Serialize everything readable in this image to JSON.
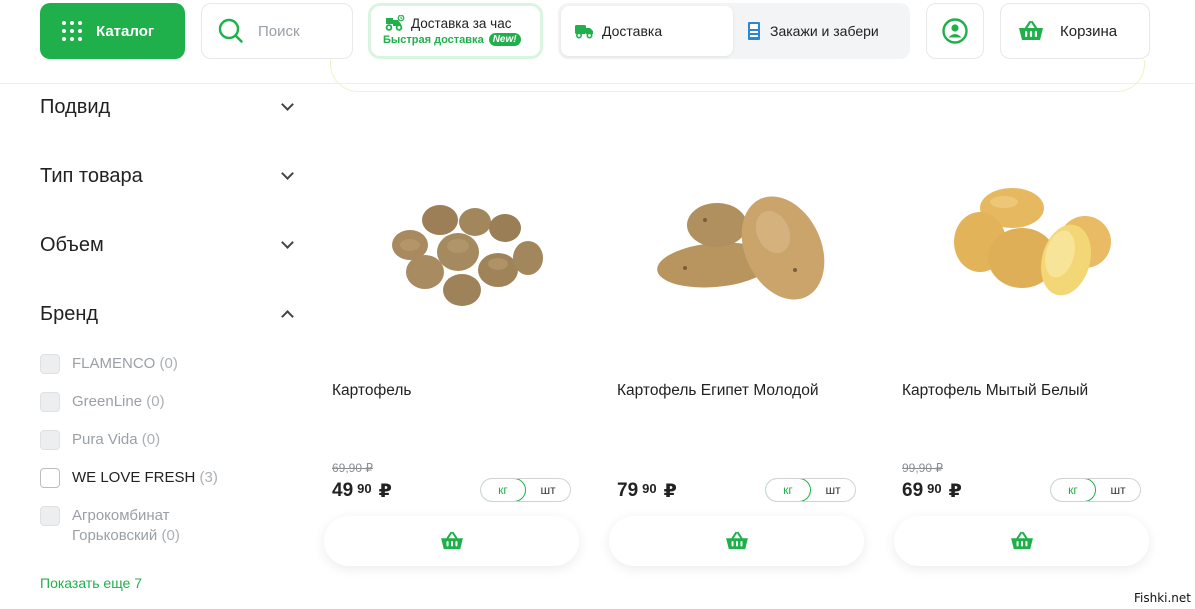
{
  "header": {
    "catalog_label": "Каталог",
    "search_placeholder": "Поиск",
    "fast_delivery": {
      "title": "Доставка за час",
      "subtitle": "Быстрая доставка",
      "badge": "New!"
    },
    "delivery_options": [
      "Доставка",
      "Закажи и забери"
    ],
    "cart_label": "Корзина"
  },
  "filters": [
    {
      "title": "Подвид",
      "expanded": false
    },
    {
      "title": "Тип товара",
      "expanded": false
    },
    {
      "title": "Объем",
      "expanded": false
    },
    {
      "title": "Бренд",
      "expanded": true
    }
  ],
  "brands": [
    {
      "name": "FLAMENCO",
      "count": "(0)",
      "enabled": false
    },
    {
      "name": "GreenLine",
      "count": "(0)",
      "enabled": false
    },
    {
      "name": "Pura Vida",
      "count": "(0)",
      "enabled": false
    },
    {
      "name": "WE LOVE FRESH",
      "count": "(3)",
      "enabled": true
    },
    {
      "name": "Агрокомбинат Горьковский",
      "count": "(0)",
      "enabled": false
    }
  ],
  "show_more": "Показать еще 7",
  "products": [
    {
      "name": "Картофель",
      "old_price": "69,90 ₽",
      "price_rub": "49",
      "price_kop": "90",
      "currency": "₽",
      "units": [
        "кг",
        "шт"
      ],
      "image": "potatoes-pile"
    },
    {
      "name": "Картофель Египет Молодой",
      "old_price": "",
      "price_rub": "79",
      "price_kop": "90",
      "currency": "₽",
      "units": [
        "кг",
        "шт"
      ],
      "image": "potatoes-egypt"
    },
    {
      "name": "Картофель Мытый Белый",
      "old_price": "99,90 ₽",
      "price_rub": "69",
      "price_kop": "90",
      "currency": "₽",
      "units": [
        "кг",
        "шт"
      ],
      "image": "potatoes-yellow"
    }
  ],
  "watermark": "Fishki.net",
  "colors": {
    "accent": "#20b04b",
    "accent_light": "#d9f4e0",
    "potato_brown": "#b3956a",
    "potato_yellow": "#f0c864"
  }
}
